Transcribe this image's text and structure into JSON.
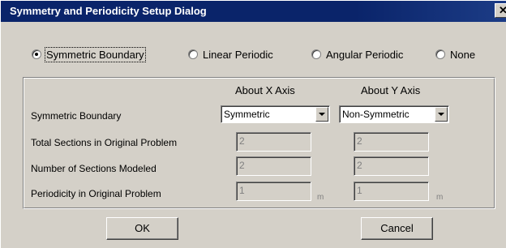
{
  "window": {
    "title": "Symmetry and Periodicity Setup Dialog",
    "close_glyph": "✕"
  },
  "boundary_types": {
    "options": [
      {
        "label": "Symmetric Boundary",
        "selected": true
      },
      {
        "label": "Linear Periodic",
        "selected": false
      },
      {
        "label": "Angular Periodic",
        "selected": false
      },
      {
        "label": "None",
        "selected": false
      }
    ]
  },
  "table": {
    "columns": [
      "About X Axis",
      "About Y Axis"
    ],
    "rows": {
      "symmetric_boundary": {
        "label": "Symmetric Boundary",
        "x_value": "Symmetric",
        "y_value": "Non-Symmetric"
      },
      "total_sections": {
        "label": "Total Sections in Original Problem",
        "x_value": "2",
        "y_value": "2"
      },
      "sections_modeled": {
        "label": "Number of Sections Modeled",
        "x_value": "2",
        "y_value": "2"
      },
      "periodicity": {
        "label": "Periodicity in Original Problem",
        "x_value": "1",
        "y_value": "1",
        "unit": "m"
      }
    }
  },
  "buttons": {
    "ok": "OK",
    "cancel": "Cancel"
  },
  "colors": {
    "titlebar": "#0a246a",
    "face": "#d4d0c8",
    "disabled_text": "#808080"
  }
}
